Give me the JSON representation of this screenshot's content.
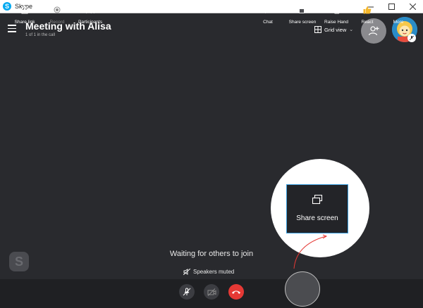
{
  "window": {
    "title": "Skype",
    "logo_letter": "S"
  },
  "header": {
    "title": "Meeting with Alisa",
    "subtitle": "1 of 1 in the call",
    "grid_view_label": "Grid view"
  },
  "main": {
    "waiting_text": "Waiting for others to join",
    "speakers_muted_text": "Speakers muted",
    "watermark_letter": "S"
  },
  "spotlight": {
    "label": "Share screen"
  },
  "toolbar": {
    "share_link": "Share link",
    "record": "Record",
    "participants": "Participants",
    "chat": "Chat",
    "share_screen": "Share screen",
    "raise_hand": "Raise Hand",
    "react": "React",
    "more": "More"
  },
  "colors": {
    "background": "#292a2e",
    "toolbar": "#1f2023",
    "end_call": "#e53935",
    "accent": "#3aa0e0"
  }
}
